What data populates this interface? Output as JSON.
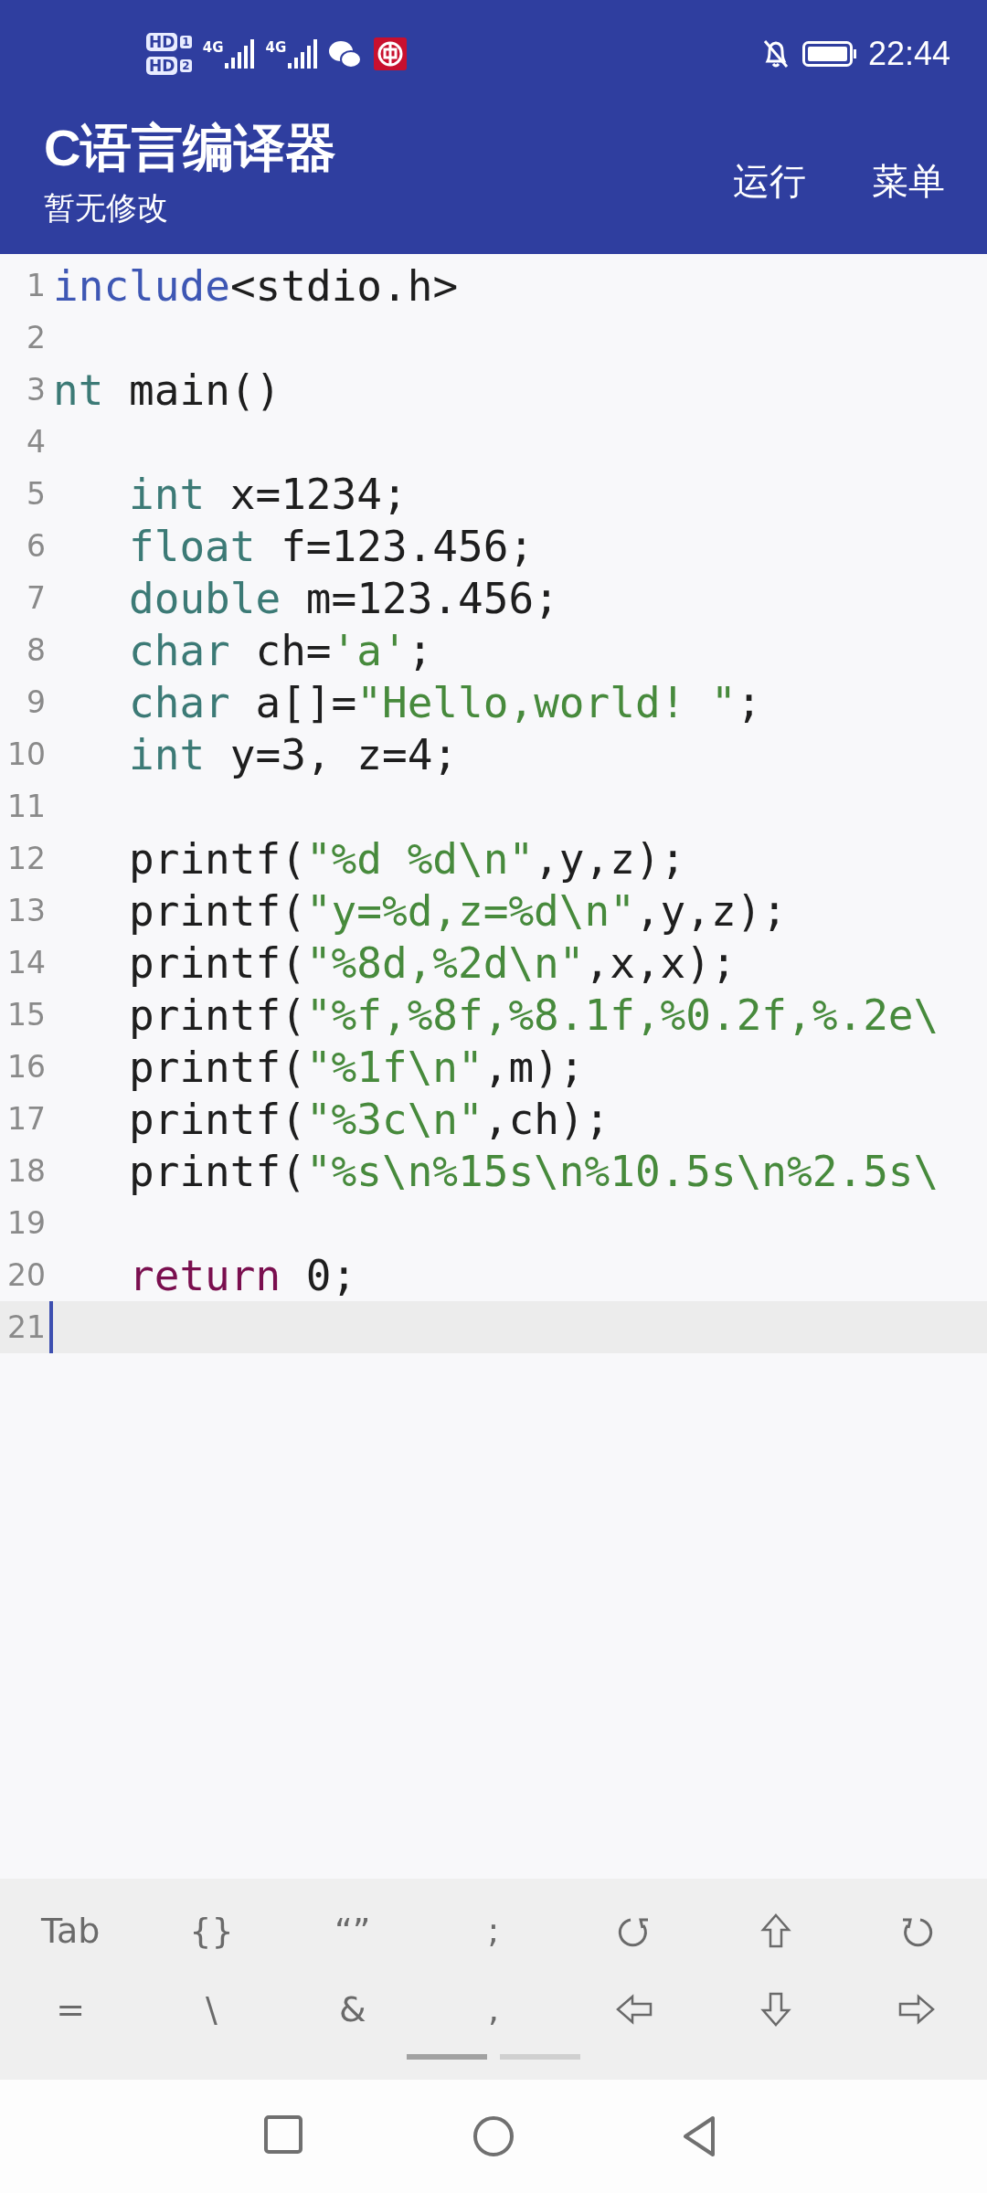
{
  "status_bar": {
    "sim_badges": [
      {
        "label": "HD",
        "slot": "1"
      },
      {
        "label": "HD",
        "slot": "2"
      }
    ],
    "networks": [
      {
        "label": "4G"
      },
      {
        "label": "4G"
      }
    ],
    "time": "22:44"
  },
  "app_bar": {
    "title": "C语言编译器",
    "subtitle": "暂无修改",
    "actions": [
      "运行",
      "菜单"
    ]
  },
  "editor": {
    "lines": [
      {
        "number": "1",
        "current": false,
        "tokens": [
          {
            "kind": "directive",
            "text": "include"
          },
          {
            "kind": "plain",
            "text": "<stdio.h>"
          }
        ]
      },
      {
        "number": "2",
        "current": false
      },
      {
        "number": "3",
        "current": false,
        "tokens": [
          {
            "kind": "type",
            "text": "nt"
          },
          {
            "kind": "plain",
            "text": " main()"
          }
        ]
      },
      {
        "number": "4",
        "current": false
      },
      {
        "number": "5",
        "current": false,
        "indented": true,
        "tokens": [
          {
            "kind": "type",
            "text": "int"
          },
          {
            "kind": "plain",
            "text": " x=1234;"
          }
        ]
      },
      {
        "number": "6",
        "current": false,
        "indented": true,
        "tokens": [
          {
            "kind": "type",
            "text": "float"
          },
          {
            "kind": "plain",
            "text": " f=123.456;"
          }
        ]
      },
      {
        "number": "7",
        "current": false,
        "indented": true,
        "tokens": [
          {
            "kind": "type",
            "text": "double"
          },
          {
            "kind": "plain",
            "text": " m=123.456;"
          }
        ]
      },
      {
        "number": "8",
        "current": false,
        "indented": true,
        "tokens": [
          {
            "kind": "type",
            "text": "char"
          },
          {
            "kind": "plain",
            "text": " ch="
          },
          {
            "kind": "string",
            "text": "'a'"
          },
          {
            "kind": "plain",
            "text": ";"
          }
        ]
      },
      {
        "number": "9",
        "current": false,
        "indented": true,
        "tokens": [
          {
            "kind": "type",
            "text": "char"
          },
          {
            "kind": "plain",
            "text": " a[]="
          },
          {
            "kind": "string",
            "text": "\"Hello,world! \""
          },
          {
            "kind": "plain",
            "text": ";"
          }
        ]
      },
      {
        "number": "10",
        "current": false,
        "indented": true,
        "tokens": [
          {
            "kind": "type",
            "text": "int"
          },
          {
            "kind": "plain",
            "text": " y=3, z=4;"
          }
        ]
      },
      {
        "number": "11",
        "current": false
      },
      {
        "number": "12",
        "current": false,
        "indented": true,
        "tokens": [
          {
            "kind": "plain",
            "text": "printf("
          },
          {
            "kind": "string",
            "text": "\"%d %d\\n\""
          },
          {
            "kind": "plain",
            "text": ",y,z);"
          }
        ]
      },
      {
        "number": "13",
        "current": false,
        "indented": true,
        "tokens": [
          {
            "kind": "plain",
            "text": "printf("
          },
          {
            "kind": "string",
            "text": "\"y=%d,z=%d\\n\""
          },
          {
            "kind": "plain",
            "text": ",y,z);"
          }
        ]
      },
      {
        "number": "14",
        "current": false,
        "indented": true,
        "tokens": [
          {
            "kind": "plain",
            "text": "printf("
          },
          {
            "kind": "string",
            "text": "\"%8d,%2d\\n\""
          },
          {
            "kind": "plain",
            "text": ",x,x);"
          }
        ]
      },
      {
        "number": "15",
        "current": false,
        "indented": true,
        "tokens": [
          {
            "kind": "plain",
            "text": "printf("
          },
          {
            "kind": "string",
            "text": "\"%f,%8f,%8.1f,%0.2f,%.2e\\"
          }
        ]
      },
      {
        "number": "16",
        "current": false,
        "indented": true,
        "tokens": [
          {
            "kind": "plain",
            "text": "printf("
          },
          {
            "kind": "string",
            "text": "\"%1f\\n\""
          },
          {
            "kind": "plain",
            "text": ",m);"
          }
        ]
      },
      {
        "number": "17",
        "current": false,
        "indented": true,
        "tokens": [
          {
            "kind": "plain",
            "text": "printf("
          },
          {
            "kind": "string",
            "text": "\"%3c\\n\""
          },
          {
            "kind": "plain",
            "text": ",ch);"
          }
        ]
      },
      {
        "number": "18",
        "current": false,
        "indented": true,
        "tokens": [
          {
            "kind": "plain",
            "text": "printf("
          },
          {
            "kind": "string",
            "text": "\"%s\\n%15s\\n%10.5s\\n%2.5s\\"
          }
        ]
      },
      {
        "number": "19",
        "current": false
      },
      {
        "number": "20",
        "current": false,
        "indented": true,
        "tokens": [
          {
            "kind": "keyword",
            "text": "return"
          },
          {
            "kind": "plain",
            "text": " 0;"
          }
        ]
      },
      {
        "number": "21",
        "current": true
      }
    ]
  },
  "key_bar": {
    "rows": [
      [
        {
          "kind": "text",
          "text": "Tab"
        },
        {
          "kind": "text",
          "text": "{}"
        },
        {
          "kind": "text",
          "text": "“”"
        },
        {
          "kind": "text",
          "text": ";"
        },
        {
          "kind": "undo"
        },
        {
          "kind": "up"
        },
        {
          "kind": "redo"
        }
      ],
      [
        {
          "kind": "text",
          "text": "="
        },
        {
          "kind": "text",
          "text": "\\"
        },
        {
          "kind": "text",
          "text": "&"
        },
        {
          "kind": "text",
          "text": ","
        },
        {
          "kind": "left"
        },
        {
          "kind": "down"
        },
        {
          "kind": "right"
        }
      ]
    ],
    "pages": [
      {
        "selected": true
      },
      {
        "selected": false
      }
    ]
  }
}
